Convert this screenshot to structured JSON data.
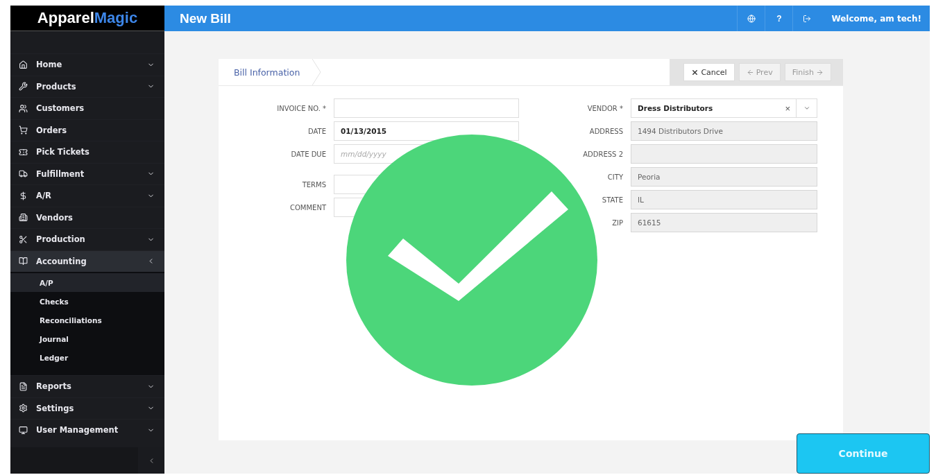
{
  "logo": {
    "part_1": "Apparel",
    "part_2": "Magic"
  },
  "header": {
    "title": "New Bill",
    "help": "?",
    "welcome": "Welcome, am tech!"
  },
  "sidebar": {
    "items": [
      {
        "label": "Home",
        "kind": "group",
        "expanded": false
      },
      {
        "label": "Products",
        "kind": "group",
        "expanded": false
      },
      {
        "label": "Customers",
        "kind": "link"
      },
      {
        "label": "Orders",
        "kind": "link"
      },
      {
        "label": "Pick Tickets",
        "kind": "link"
      },
      {
        "label": "Fulfillment",
        "kind": "group",
        "expanded": false
      },
      {
        "label": "A/R",
        "kind": "group",
        "expanded": false
      },
      {
        "label": "Vendors",
        "kind": "link"
      },
      {
        "label": "Production",
        "kind": "group",
        "expanded": false
      },
      {
        "label": "Accounting",
        "kind": "group",
        "expanded": true,
        "children": [
          {
            "label": "A/P",
            "selected": true
          },
          {
            "label": "Checks",
            "selected": false
          },
          {
            "label": "Reconciliations",
            "selected": false
          },
          {
            "label": "Journal",
            "selected": false
          },
          {
            "label": "Ledger",
            "selected": false
          }
        ]
      },
      {
        "label": "Reports",
        "kind": "group",
        "expanded": false
      },
      {
        "label": "Settings",
        "kind": "group",
        "expanded": false
      },
      {
        "label": "User Management",
        "kind": "group",
        "expanded": false
      }
    ]
  },
  "wizard": {
    "step": "Bill Information",
    "buttons": [
      {
        "label": "Cancel",
        "kind": "cancel",
        "disabled": false
      },
      {
        "label": "Prev",
        "kind": "prev",
        "disabled": true
      },
      {
        "label": "Finish",
        "kind": "next",
        "disabled": true
      }
    ]
  },
  "left_groups": [
    [
      {
        "label": "INVOICE NO. *"
      },
      {
        "label": "DATE",
        "value": "01/13/2015"
      },
      {
        "label": "DATE DUE",
        "placeholder": "mm/dd/yyyy"
      }
    ],
    [
      {
        "label": "TERMS"
      },
      {
        "label": "COMMENT"
      }
    ]
  ],
  "vendor": {
    "label": "VENDOR *",
    "value": "Dress Distributors",
    "clear": "×"
  },
  "right_fields": [
    {
      "label": "ADDRESS",
      "value": "1494 Distributors Drive",
      "disabled": true
    },
    {
      "label": "ADDRESS 2",
      "disabled": true
    },
    {
      "label": "CITY",
      "value": "Peoria",
      "disabled": true
    },
    {
      "label": "STATE",
      "value": "IL",
      "disabled": true
    },
    {
      "label": "ZIP",
      "value": "61615",
      "disabled": true
    }
  ],
  "continue_button": "Continue"
}
